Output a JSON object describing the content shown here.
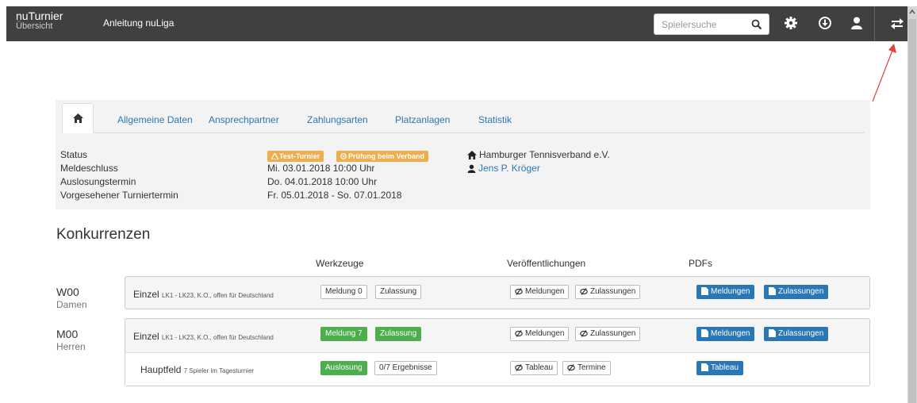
{
  "navbar": {
    "brand_title": "nuTurnier",
    "brand_subtitle": "Übersicht",
    "link": "Anleitung nuLiga",
    "search_placeholder": "Spielersuche"
  },
  "tabs": [
    "Allgemeine Daten",
    "Ansprechpartner",
    "Zahlungsarten",
    "Platzanlagen",
    "Statistik"
  ],
  "info": {
    "labels": [
      "Status",
      "Meldeschluss",
      "Auslosungstermin",
      "Vorgesehener Turniertermin"
    ],
    "badges": [
      "Test-Turnier",
      "Prüfung beim Verband"
    ],
    "meldeschluss": "Mi. 03.01.2018 10:00 Uhr",
    "auslosung": "Do. 04.01.2018 10:00 Uhr",
    "termin": "Fr. 05.01.2018 - So. 07.01.2018",
    "organization": "Hamburger Tennisverband e.V.",
    "contact": "Jens P. Kröger"
  },
  "section_title": "Konkurrenzen",
  "columns": [
    "Werkzeuge",
    "Veröffentlichungen",
    "PDFs"
  ],
  "categories": [
    {
      "code": "W00",
      "label": "Damen",
      "event": "Einzel",
      "event_detail": "LK1 - LK23, K.O., offen für Deutschland",
      "tools": [
        "Meldung 0",
        "Zulassung"
      ],
      "publications": [
        "Meldungen",
        "Zulassungen"
      ],
      "pdfs": [
        "Meldungen",
        "Zulassungen"
      ]
    },
    {
      "code": "M00",
      "label": "Herren",
      "event": "Einzel",
      "event_detail": "LK1 - LK23, K.O., offen für Deutschland",
      "tools": [
        "Meldung 7",
        "Zulassung"
      ],
      "publications": [
        "Meldungen",
        "Zulassungen"
      ],
      "pdfs": [
        "Meldungen",
        "Zulassungen"
      ],
      "sub": {
        "name": "Hauptfeld",
        "detail": "7 Spieler im Tagesturnier",
        "tools": [
          "Auslosung",
          "0/7 Ergebnisse"
        ],
        "publications": [
          "Tableau",
          "Termine"
        ],
        "pdfs": [
          "Tableau"
        ]
      }
    }
  ],
  "colors": {
    "navbar": "#404040",
    "link": "#2a77b6",
    "success": "#4cae4c",
    "warning": "#f0ad4e",
    "primary": "#2a77b6"
  }
}
